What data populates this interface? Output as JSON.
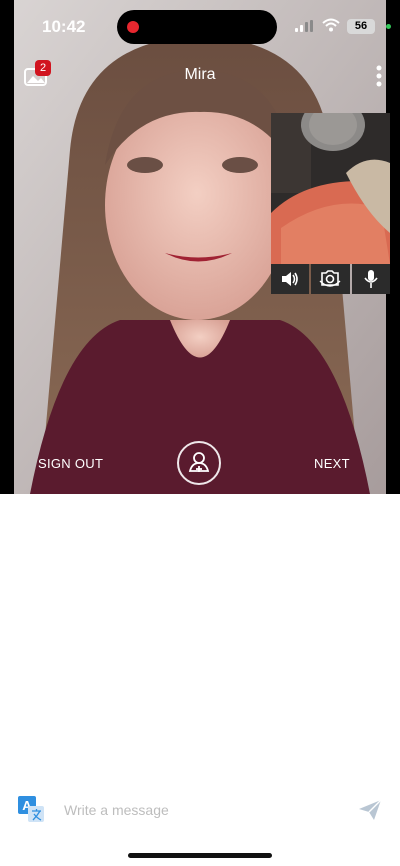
{
  "status_bar": {
    "time": "10:42",
    "battery": "56"
  },
  "header": {
    "notification_count": "2",
    "peer_name": "Mira"
  },
  "controls": {
    "sign_out_label": "SIGN OUT",
    "next_label": "NEXT"
  },
  "composer": {
    "placeholder": "Write a message"
  },
  "icons": {
    "gallery": "gallery-icon",
    "more": "more-vertical-icon",
    "speaker": "speaker-icon",
    "camera_switch": "camera-switch-icon",
    "microphone": "microphone-icon",
    "add_friend": "add-friend-icon",
    "translate": "translate-icon",
    "send": "send-icon"
  },
  "colors": {
    "badge": "#d1141f",
    "recording": "#e8272f",
    "translate": "#2f8fe0",
    "send": "#b9c6d3"
  }
}
